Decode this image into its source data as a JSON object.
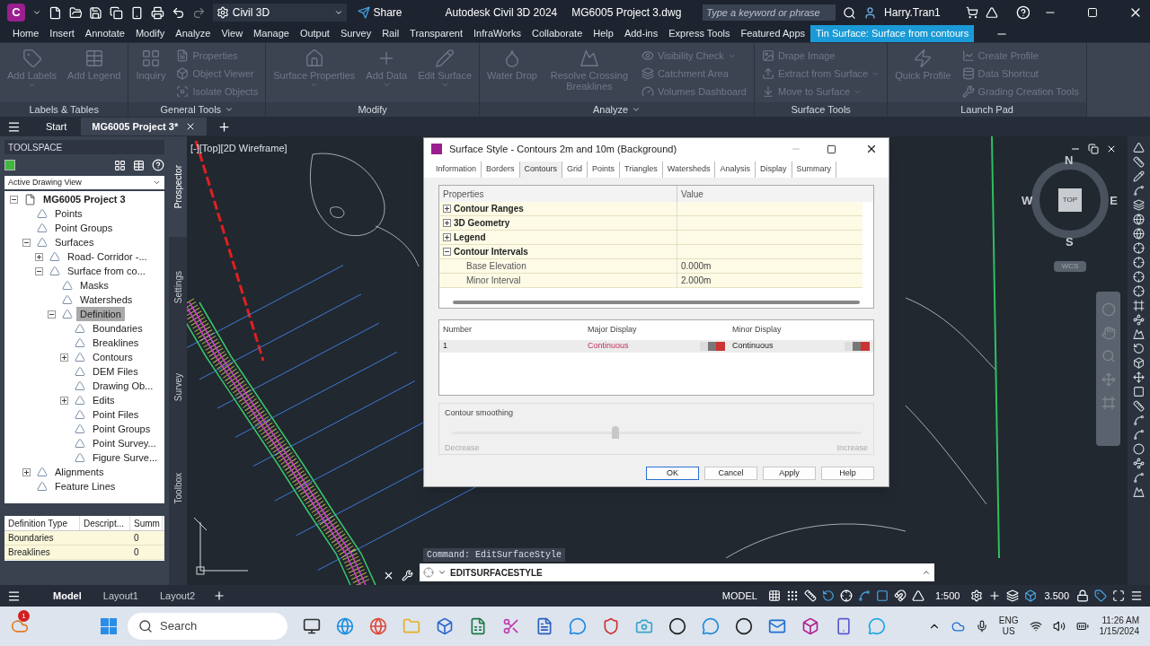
{
  "title_bar": {
    "logo": "C",
    "workspace": "Civil 3D",
    "share": "Share",
    "app_title": "Autodesk Civil 3D 2024",
    "file_title": "MG6005 Project 3.dwg",
    "search": {
      "placeholder": "Type a keyword or phrase"
    },
    "user": "Harry.Tran1"
  },
  "ribbon_tabs": [
    {
      "label": "Home",
      "selected": false
    },
    {
      "label": "Insert",
      "selected": false
    },
    {
      "label": "Annotate",
      "selected": false
    },
    {
      "label": "Modify",
      "selected": false
    },
    {
      "label": "Analyze",
      "selected": false
    },
    {
      "label": "View",
      "selected": false
    },
    {
      "label": "Manage",
      "selected": false
    },
    {
      "label": "Output",
      "selected": false
    },
    {
      "label": "Survey",
      "selected": false
    },
    {
      "label": "Rail",
      "selected": false
    },
    {
      "label": "Transparent",
      "selected": false
    },
    {
      "label": "InfraWorks",
      "selected": false
    },
    {
      "label": "Collaborate",
      "selected": false
    },
    {
      "label": "Help",
      "selected": false
    },
    {
      "label": "Add-ins",
      "selected": false
    },
    {
      "label": "Express Tools",
      "selected": false
    },
    {
      "label": "Featured Apps",
      "selected": false
    },
    {
      "label": "Tin Surface: Surface from contours",
      "selected": true
    }
  ],
  "ribbon_panels": [
    {
      "title": "Labels & Tables",
      "menu": false,
      "items": [
        {
          "kind": "large",
          "label": "Add Labels",
          "disabled": true,
          "dropdown": true
        },
        {
          "kind": "large",
          "label": "Add Legend",
          "disabled": true
        }
      ]
    },
    {
      "title": "General Tools",
      "menu": true,
      "items": [
        {
          "kind": "large",
          "label": "Inquiry",
          "disabled": true
        },
        {
          "kind": "small",
          "label": "Properties",
          "disabled": true
        },
        {
          "kind": "small",
          "label": "Object Viewer",
          "disabled": true
        },
        {
          "kind": "small",
          "label": "Isolate Objects",
          "disabled": true
        }
      ]
    },
    {
      "title": "Modify",
      "menu": false,
      "items": [
        {
          "kind": "large",
          "label": "Surface Properties",
          "disabled": true,
          "dropdown": true
        },
        {
          "kind": "large",
          "label": "Add Data",
          "disabled": true,
          "dropdown": true
        },
        {
          "kind": "large",
          "label": "Edit Surface",
          "disabled": true,
          "dropdown": true
        }
      ]
    },
    {
      "title": "Analyze",
      "menu": true,
      "items": [
        {
          "kind": "large",
          "label": "Water Drop",
          "disabled": true
        },
        {
          "kind": "large",
          "label": "Resolve Crossing Breaklines",
          "disabled": true
        },
        {
          "kind": "small",
          "label": "Visibility Check",
          "disabled": true,
          "dropdown": true
        },
        {
          "kind": "small",
          "label": "Catchment Area",
          "disabled": true
        },
        {
          "kind": "small",
          "label": "Volumes Dashboard",
          "disabled": true
        }
      ]
    },
    {
      "title": "Surface Tools",
      "menu": false,
      "items": [
        {
          "kind": "small",
          "label": "Drape Image",
          "disabled": true
        },
        {
          "kind": "small",
          "label": "Extract from Surface",
          "disabled": true,
          "dropdown": true
        },
        {
          "kind": "small",
          "label": "Move to Surface",
          "disabled": true,
          "dropdown": true
        }
      ]
    },
    {
      "title": "Launch Pad",
      "menu": false,
      "items": [
        {
          "kind": "large",
          "label": "Quick Profile",
          "disabled": true
        },
        {
          "kind": "small",
          "label": "Create Profile",
          "disabled": true
        },
        {
          "kind": "small",
          "label": "Data Shortcut",
          "disabled": true
        },
        {
          "kind": "small",
          "label": "Grading Creation Tools",
          "disabled": true
        }
      ]
    }
  ],
  "file_tabs": [
    {
      "label": "Start",
      "selected": false
    },
    {
      "label": "MG6005 Project 3*",
      "selected": true
    }
  ],
  "toolspace": {
    "title": "TOOLSPACE",
    "view_select": "Active Drawing View",
    "tree": [
      {
        "label": "MG6005 Project 3",
        "expanded": true,
        "selected": false,
        "children": [
          {
            "label": "Points",
            "selected": false
          },
          {
            "label": "Point Groups",
            "selected": false
          },
          {
            "label": "Surfaces",
            "expanded": true,
            "selected": false,
            "children": [
              {
                "label": "Road- Corridor -...",
                "expanded": false,
                "selected": false
              },
              {
                "label": "Surface from co...",
                "expanded": true,
                "selected": false,
                "children": [
                  {
                    "label": "Masks",
                    "selected": false
                  },
                  {
                    "label": "Watersheds",
                    "selected": false
                  },
                  {
                    "label": "Definition",
                    "expanded": true,
                    "selected": true,
                    "children": [
                      {
                        "label": "Boundaries",
                        "selected": false
                      },
                      {
                        "label": "Breaklines",
                        "selected": false
                      },
                      {
                        "label": "Contours",
                        "expanded": false,
                        "selected": false
                      },
                      {
                        "label": "DEM Files",
                        "selected": false
                      },
                      {
                        "label": "Drawing Ob...",
                        "selected": false
                      },
                      {
                        "label": "Edits",
                        "expanded": false,
                        "selected": false
                      },
                      {
                        "label": "Point Files",
                        "selected": false
                      },
                      {
                        "label": "Point Groups",
                        "selected": false
                      },
                      {
                        "label": "Point Survey...",
                        "selected": false
                      },
                      {
                        "label": "Figure Surve...",
                        "selected": false
                      }
                    ]
                  }
                ]
              }
            ]
          },
          {
            "label": "Alignments",
            "expanded": false,
            "selected": false
          },
          {
            "label": "Feature Lines",
            "selected": false
          }
        ]
      }
    ],
    "side_tabs": [
      {
        "label": "Prospector",
        "selected": true
      },
      {
        "label": "Settings",
        "selected": false
      },
      {
        "label": "Survey",
        "selected": false
      },
      {
        "label": "Toolbox",
        "selected": false
      }
    ],
    "detail_table": {
      "columns": [
        "Definition Type",
        "Descript...",
        "Summ"
      ],
      "rows": [
        [
          "Boundaries",
          "",
          "0"
        ],
        [
          "Breaklines",
          "",
          "0"
        ]
      ]
    }
  },
  "viewport": {
    "label": "[-][Top][2D Wireframe]",
    "viewcube": {
      "north": "N",
      "south": "S",
      "east": "E",
      "west": "W",
      "face": "TOP",
      "ucs": "WCS"
    }
  },
  "dialog": {
    "title": "Surface Style - Contours 2m and 10m (Background)",
    "tabs": [
      {
        "label": "Information",
        "selected": false
      },
      {
        "label": "Borders",
        "selected": false
      },
      {
        "label": "Contours",
        "selected": true
      },
      {
        "label": "Grid",
        "selected": false
      },
      {
        "label": "Points",
        "selected": false
      },
      {
        "label": "Triangles",
        "selected": false
      },
      {
        "label": "Watersheds",
        "selected": false
      },
      {
        "label": "Analysis",
        "selected": false
      },
      {
        "label": "Display",
        "selected": false
      },
      {
        "label": "Summary",
        "selected": false
      }
    ],
    "grid_columns": [
      "Properties",
      "Value"
    ],
    "grid_rows": [
      {
        "kind": "group",
        "label": "Contour Ranges",
        "expanded": false
      },
      {
        "kind": "group",
        "label": "3D Geometry",
        "expanded": false
      },
      {
        "kind": "group",
        "label": "Legend",
        "expanded": false
      },
      {
        "kind": "group",
        "label": "Contour Intervals",
        "expanded": true
      },
      {
        "kind": "property",
        "label": "Base Elevation",
        "value": "0.000m"
      },
      {
        "kind": "property",
        "label": "Minor Interval",
        "value": "2.000m"
      }
    ],
    "display_columns": [
      "Number",
      "Major Display",
      "Minor Display"
    ],
    "display_rows": [
      {
        "number": "1",
        "major": "Continuous",
        "minor": "Continuous",
        "selected": true
      }
    ],
    "smoothing": {
      "label": "Contour smoothing",
      "level": 0.4,
      "disabled": true,
      "min_label": "Decrease",
      "max_label": "Increase"
    },
    "buttons": [
      {
        "label": "OK",
        "default": true
      },
      {
        "label": "Cancel",
        "default": false
      },
      {
        "label": "Apply",
        "default": false
      },
      {
        "label": "Help",
        "default": false
      }
    ]
  },
  "command_line": {
    "history": "Command: EditSurfaceStyle",
    "value": "EDITSURFACESTYLE"
  },
  "layout_tabs": [
    {
      "label": "Model",
      "selected": true
    },
    {
      "label": "Layout1",
      "selected": false
    },
    {
      "label": "Layout2",
      "selected": false
    }
  ],
  "status_bar": {
    "space": "MODEL",
    "scale": "1:500",
    "value": "3.500"
  },
  "taskbar": {
    "badge": "1",
    "search": {
      "placeholder": "Search"
    },
    "language": "ENG",
    "region": "US",
    "time": "11:26 AM",
    "date": "1/15/2024"
  }
}
